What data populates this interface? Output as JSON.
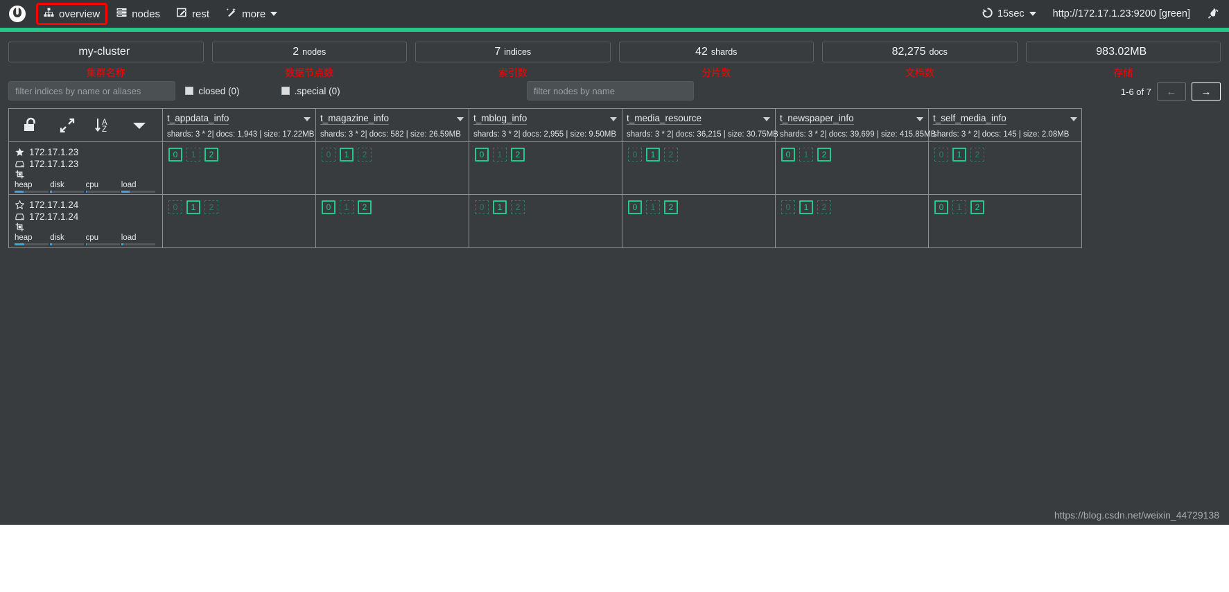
{
  "navbar": {
    "brand_icon": "cerebro-logo-icon",
    "items": [
      {
        "label": "overview",
        "icon": "sitemap-icon",
        "highlighted": true
      },
      {
        "label": "nodes",
        "icon": "server-list-icon",
        "highlighted": false
      },
      {
        "label": "rest",
        "icon": "edit-square-icon",
        "highlighted": false
      },
      {
        "label": "more",
        "icon": "magic-wand-icon",
        "highlighted": false,
        "has_caret": true
      }
    ],
    "refresh": {
      "icon": "refresh-icon",
      "label": "15sec",
      "has_caret": true
    },
    "node_url": "http://172.17.1.23:9200 [green]",
    "plug_icon": "plug-disconnect-icon",
    "health_color": "#25c489"
  },
  "stats": [
    {
      "value": "my-cluster",
      "unit": "",
      "note": "集群名称"
    },
    {
      "value": "2",
      "unit": "nodes",
      "note": "数据节点数"
    },
    {
      "value": "7",
      "unit": "indices",
      "note": "索引数"
    },
    {
      "value": "42",
      "unit": "shards",
      "note": "分片数"
    },
    {
      "value": "82,275",
      "unit": "docs",
      "note": "文档数"
    },
    {
      "value": "983.02MB",
      "unit": "",
      "note": "存储"
    }
  ],
  "filters": {
    "index_filter": {
      "placeholder": "filter indices by name or aliases",
      "value": ""
    },
    "checkboxes": [
      {
        "label": "closed (0)",
        "checked": false
      },
      {
        "label": ".special (0)",
        "checked": false
      }
    ],
    "node_filter": {
      "placeholder": "filter nodes by name",
      "value": ""
    },
    "pager": {
      "range_label": "1-6 of 7",
      "prev_label": "←",
      "next_label": "→",
      "prev_enabled": false,
      "next_enabled": true
    }
  },
  "grid": {
    "controls": [
      {
        "icon": "unlock-icon",
        "name": "toggle-shard-allocation"
      },
      {
        "icon": "expand-arrows-icon",
        "name": "toggle-fullscreen"
      },
      {
        "icon": "sort-alpha-asc-icon",
        "name": "sort-indices"
      },
      {
        "icon": "caret-down-icon",
        "name": "sort-options-dropdown"
      }
    ],
    "nodes": [
      {
        "name": "172.17.1.23",
        "host": "172.17.1.23",
        "master": true,
        "master_icon": "star-filled-icon",
        "host_icon": "hdd-icon",
        "role_icon": "node-role-icon",
        "bars": [
          {
            "label": "heap",
            "percent": 26
          },
          {
            "label": "disk",
            "percent": 5
          },
          {
            "label": "cpu",
            "percent": 4
          },
          {
            "label": "load",
            "percent": 24
          }
        ]
      },
      {
        "name": "172.17.1.24",
        "host": "172.17.1.24",
        "master": false,
        "master_icon": "star-outline-icon",
        "host_icon": "hdd-icon",
        "role_icon": "node-role-icon",
        "bars": [
          {
            "label": "heap",
            "percent": 28
          },
          {
            "label": "disk",
            "percent": 5
          },
          {
            "label": "cpu",
            "percent": 4
          },
          {
            "label": "load",
            "percent": 6
          }
        ]
      }
    ],
    "indices": [
      {
        "name": "t_appdata_info",
        "meta": "shards: 3 * 2| docs: 1,943 | size: 17.22MB",
        "shards": [
          [
            {
              "id": "0",
              "type": "primary"
            },
            {
              "id": "1",
              "type": "replica"
            },
            {
              "id": "2",
              "type": "primary"
            }
          ],
          [
            {
              "id": "0",
              "type": "replica"
            },
            {
              "id": "1",
              "type": "primary"
            },
            {
              "id": "2",
              "type": "replica"
            }
          ]
        ]
      },
      {
        "name": "t_magazine_info",
        "meta": "shards: 3 * 2| docs: 582 | size: 26.59MB",
        "shards": [
          [
            {
              "id": "0",
              "type": "replica"
            },
            {
              "id": "1",
              "type": "primary"
            },
            {
              "id": "2",
              "type": "replica"
            }
          ],
          [
            {
              "id": "0",
              "type": "primary"
            },
            {
              "id": "1",
              "type": "replica"
            },
            {
              "id": "2",
              "type": "primary"
            }
          ]
        ]
      },
      {
        "name": "t_mblog_info",
        "meta": "shards: 3 * 2| docs: 2,955 | size: 9.50MB",
        "shards": [
          [
            {
              "id": "0",
              "type": "primary"
            },
            {
              "id": "1",
              "type": "replica"
            },
            {
              "id": "2",
              "type": "primary"
            }
          ],
          [
            {
              "id": "0",
              "type": "replica"
            },
            {
              "id": "1",
              "type": "primary"
            },
            {
              "id": "2",
              "type": "replica"
            }
          ]
        ]
      },
      {
        "name": "t_media_resource",
        "meta": "shards: 3 * 2| docs: 36,215 | size: 30.75MB",
        "shards": [
          [
            {
              "id": "0",
              "type": "replica"
            },
            {
              "id": "1",
              "type": "primary"
            },
            {
              "id": "2",
              "type": "replica"
            }
          ],
          [
            {
              "id": "0",
              "type": "primary"
            },
            {
              "id": "1",
              "type": "replica"
            },
            {
              "id": "2",
              "type": "primary"
            }
          ]
        ]
      },
      {
        "name": "t_newspaper_info",
        "meta": "shards: 3 * 2| docs: 39,699 | size: 415.85MB",
        "shards": [
          [
            {
              "id": "0",
              "type": "primary"
            },
            {
              "id": "1",
              "type": "replica"
            },
            {
              "id": "2",
              "type": "primary"
            }
          ],
          [
            {
              "id": "0",
              "type": "replica"
            },
            {
              "id": "1",
              "type": "primary"
            },
            {
              "id": "2",
              "type": "replica"
            }
          ]
        ]
      },
      {
        "name": "t_self_media_info",
        "meta": "shards: 3 * 2| docs: 145 | size: 2.08MB",
        "shards": [
          [
            {
              "id": "0",
              "type": "replica"
            },
            {
              "id": "1",
              "type": "primary"
            },
            {
              "id": "2",
              "type": "replica"
            }
          ],
          [
            {
              "id": "0",
              "type": "primary"
            },
            {
              "id": "1",
              "type": "replica"
            },
            {
              "id": "2",
              "type": "primary"
            }
          ]
        ]
      }
    ]
  },
  "watermark": "https://blog.csdn.net/weixin_44729138",
  "colors": {
    "navbar_bg": "#333739",
    "body_bg": "#383c3f",
    "health_green": "#25c489",
    "shard_primary": "#22c98c",
    "shard_replica": "#2e7f62",
    "annotation_red": "#fe0000",
    "highlight_red": "#ff0000",
    "bar_blue": "#3aa8d8"
  }
}
